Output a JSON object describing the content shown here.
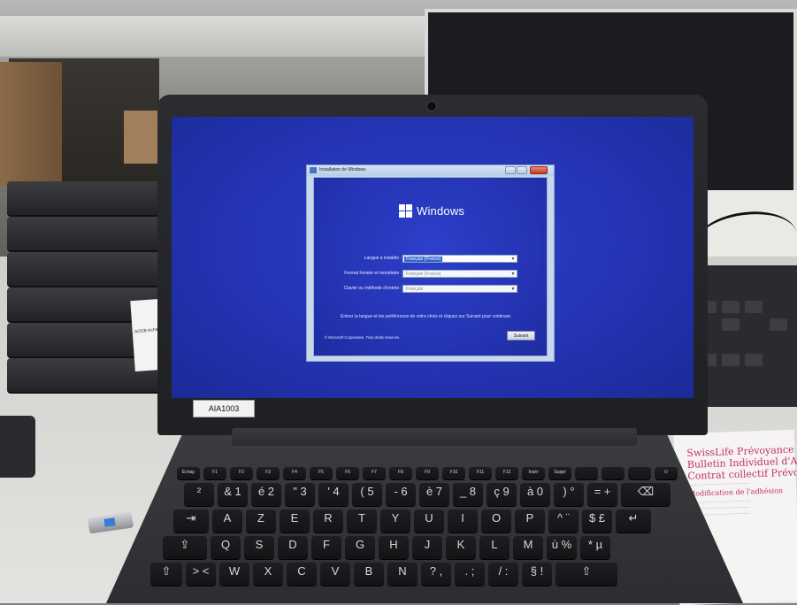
{
  "laptop": {
    "asset_tag": "AIA1003"
  },
  "dialog": {
    "title": "Installation de Windows",
    "windows_wordmark": "Windows",
    "fields": [
      {
        "label": "Langue à installer :",
        "value": "Français (France)",
        "selected": true
      },
      {
        "label": "Format horaire et monétaire :",
        "value": "Français (France)",
        "selected": false
      },
      {
        "label": "Clavier ou méthode d'entrée :",
        "value": "Français",
        "selected": false
      }
    ],
    "hint": "Entrez la langue et les préférences de votre choix et cliquez sur Suivant pour continuer.",
    "copyright": "© Microsoft Corporation. Tous droits réservés.",
    "next_label": "Suivant"
  },
  "keyboard": {
    "fn_row": [
      "Échap",
      "F1",
      "F2",
      "F3",
      "F4",
      "F5",
      "F6",
      "F7",
      "F8",
      "F9",
      "F10",
      "F11",
      "F12",
      "Insér",
      "Suppr",
      "",
      "",
      "",
      "⏻"
    ],
    "row1": [
      "²",
      "& 1",
      "é 2",
      "\" 3",
      "' 4",
      "( 5",
      "- 6",
      "è 7",
      "_ 8",
      "ç 9",
      "à 0",
      ") °",
      "= +",
      "⌫"
    ],
    "row2": [
      "⇥",
      "A",
      "Z",
      "E",
      "R",
      "T",
      "Y",
      "U",
      "I",
      "O",
      "P",
      "^ ¨",
      "$ £",
      "↵"
    ],
    "row3": [
      "⇪",
      "Q",
      "S",
      "D",
      "F",
      "G",
      "H",
      "J",
      "K",
      "L",
      "M",
      "ù %",
      "* µ"
    ],
    "row4": [
      "⇧",
      "> <",
      "W",
      "X",
      "C",
      "V",
      "B",
      "N",
      "? ,",
      ". ;",
      "/ :",
      "§ !",
      "⇧"
    ]
  },
  "background": {
    "document_lines": [
      "SwissLife Prévoyance L",
      "Bulletin Individuel d'Adh",
      "Contrat collectif Prévoy",
      "Modification de l'adhésion"
    ],
    "paper_label": "AOSB Achats"
  }
}
